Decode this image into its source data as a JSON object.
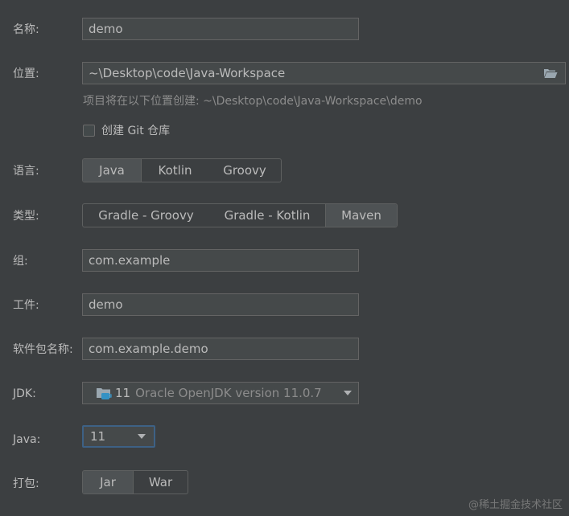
{
  "form": {
    "name": {
      "label": "名称:",
      "value": "demo"
    },
    "location": {
      "label": "位置:",
      "value": "~\\Desktop\\code\\Java-Workspace",
      "hint": "项目将在以下位置创建: ~\\Desktop\\code\\Java-Workspace\\demo"
    },
    "git_checkbox": {
      "label": "创建 Git 仓库",
      "checked": false
    },
    "language": {
      "label": "语言:",
      "options": [
        "Java",
        "Kotlin",
        "Groovy"
      ],
      "selected": "Java"
    },
    "build_type": {
      "label": "类型:",
      "options": [
        "Gradle - Groovy",
        "Gradle - Kotlin",
        "Maven"
      ],
      "selected": "Maven"
    },
    "group": {
      "label": "组:",
      "value": "com.example"
    },
    "artifact": {
      "label": "工件:",
      "value": "demo"
    },
    "package_name": {
      "label": "软件包名称:",
      "value": "com.example.demo"
    },
    "jdk": {
      "label": "JDK:",
      "version": "11",
      "name": "Oracle OpenJDK version 11.0.7",
      "icon": "jdk-folder-icon"
    },
    "java": {
      "label": "Java:",
      "value": "11"
    },
    "packaging": {
      "label": "打包:",
      "options": [
        "Jar",
        "War"
      ],
      "selected": "Jar"
    }
  },
  "icons": {
    "browse": "folder-open-icon",
    "dropdown": "chevron-down-icon"
  },
  "watermark": "@稀土掘金技术社区",
  "colors": {
    "background": "#3c3f41",
    "field_bg": "#45494a",
    "text": "#bbbbbb",
    "hint": "#8c8c8c",
    "focus_border": "#3d6185",
    "selected_segment": "#4e5254"
  }
}
